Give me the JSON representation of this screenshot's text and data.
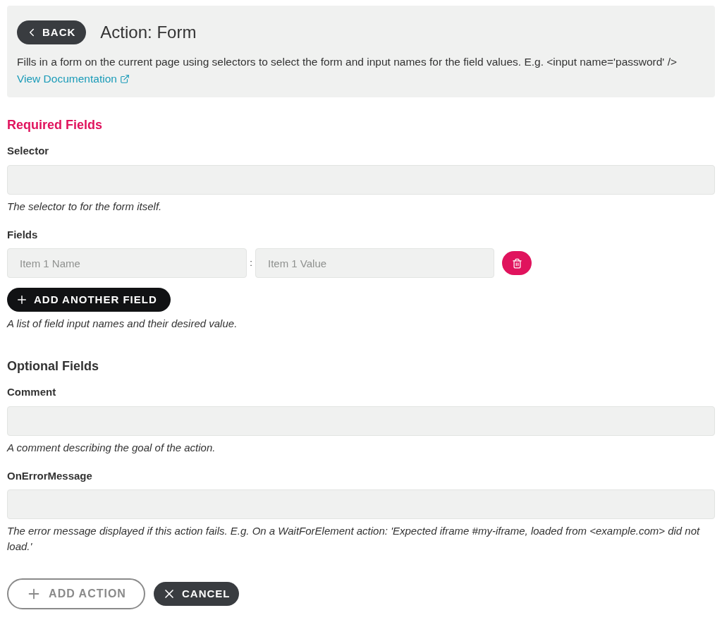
{
  "header": {
    "back_button": "BACK",
    "title": "Action: Form",
    "description": "Fills in a form on the current page using selectors to select the form and input names for the field values. E.g. <input name='password' />",
    "doc_link": "View Documentation"
  },
  "required": {
    "heading": "Required Fields",
    "fields": [
      {
        "kind": "text",
        "label": "Selector",
        "help": "The selector to for the form itself."
      },
      {
        "kind": "pairs",
        "label": "Fields",
        "items": [
          {
            "name_placeholder": "Item 1 Name",
            "separator": ":",
            "value_placeholder": "Item 1 Value"
          }
        ],
        "add_button": "ADD ANOTHER FIELD",
        "help": "A list of field input names and their desired value."
      }
    ]
  },
  "optional": {
    "heading": "Optional Fields",
    "fields": [
      {
        "kind": "text",
        "label": "Comment",
        "help": "A comment describing the goal of the action."
      },
      {
        "kind": "text",
        "label": "OnErrorMessage",
        "help": "The error message displayed if this action fails. E.g. On a WaitForElement action: 'Expected iframe #my-iframe, loaded from <example.com> did not load.'"
      }
    ]
  },
  "footer": {
    "add_action": {
      "label": "ADD ACTION",
      "disabled": true
    },
    "cancel": "CANCEL"
  }
}
